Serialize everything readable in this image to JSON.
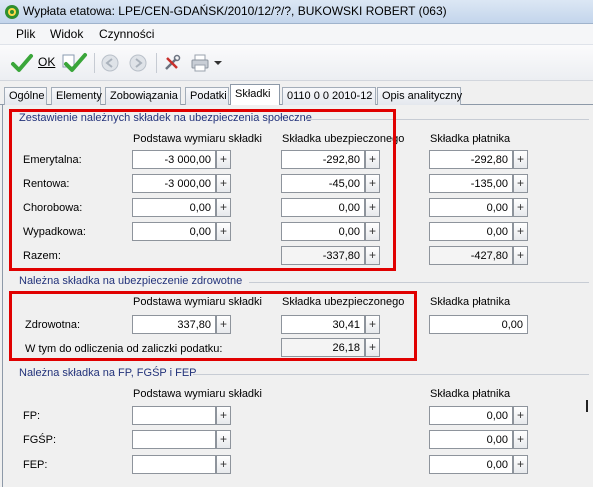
{
  "window": {
    "title": "Wypłata etatowa: LPE/CEN-GDAŃSK/2010/12/?/?, BUKOWSKI ROBERT (063)"
  },
  "menu": {
    "items": [
      "Plik",
      "Widok",
      "Czynności"
    ]
  },
  "toolbar": {
    "ok_label": "OK"
  },
  "tabs": [
    "Ogólne",
    "Elementy",
    "Zobowiązania",
    "Podatki",
    "Składki",
    "0110 0 0 2010-12",
    "Opis analityczny"
  ],
  "active_tab": "Składki",
  "social": {
    "title": "Zestawienie należnych składek na ubezpieczenia społeczne",
    "headers": [
      "Podstawa wymiaru składki",
      "Składka ubezpieczonego",
      "Składka płatnika"
    ],
    "rows": [
      {
        "label": "Emerytalna:",
        "base": "-3 000,00",
        "insured": "-292,80",
        "payer": "-292,80"
      },
      {
        "label": "Rentowa:",
        "base": "-3 000,00",
        "insured": "-45,00",
        "payer": "-135,00"
      },
      {
        "label": "Chorobowa:",
        "base": "0,00",
        "insured": "0,00",
        "payer": "0,00"
      },
      {
        "label": "Wypadkowa:",
        "base": "0,00",
        "insured": "0,00",
        "payer": "0,00"
      }
    ],
    "total": {
      "label": "Razem:",
      "insured": "-337,80",
      "payer": "-427,80"
    }
  },
  "health": {
    "title": "Należna składka na ubezpieczenie zdrowotne",
    "headers": [
      "Podstawa wymiaru składki",
      "Składka ubezpieczonego",
      "Składka płatnika"
    ],
    "row": {
      "label": "Zdrowotna:",
      "base": "337,80",
      "insured": "30,41",
      "payer": "0,00"
    },
    "deduct": {
      "label": "W tym do odliczenia od zaliczki podatku:",
      "value": "26,18"
    }
  },
  "funds": {
    "title": "Należna składka na FP, FGŚP i FEP",
    "headers": [
      "Podstawa wymiaru składki",
      "Składka płatnika"
    ],
    "rows": [
      {
        "label": "FP:",
        "payer": "0,00"
      },
      {
        "label": "FGŚP:",
        "payer": "0,00"
      },
      {
        "label": "FEP:",
        "payer": "0,00"
      }
    ]
  },
  "colors": {
    "highlight": "#e00000",
    "group_title": "#22327a",
    "ok_green": "#3aa63a"
  }
}
